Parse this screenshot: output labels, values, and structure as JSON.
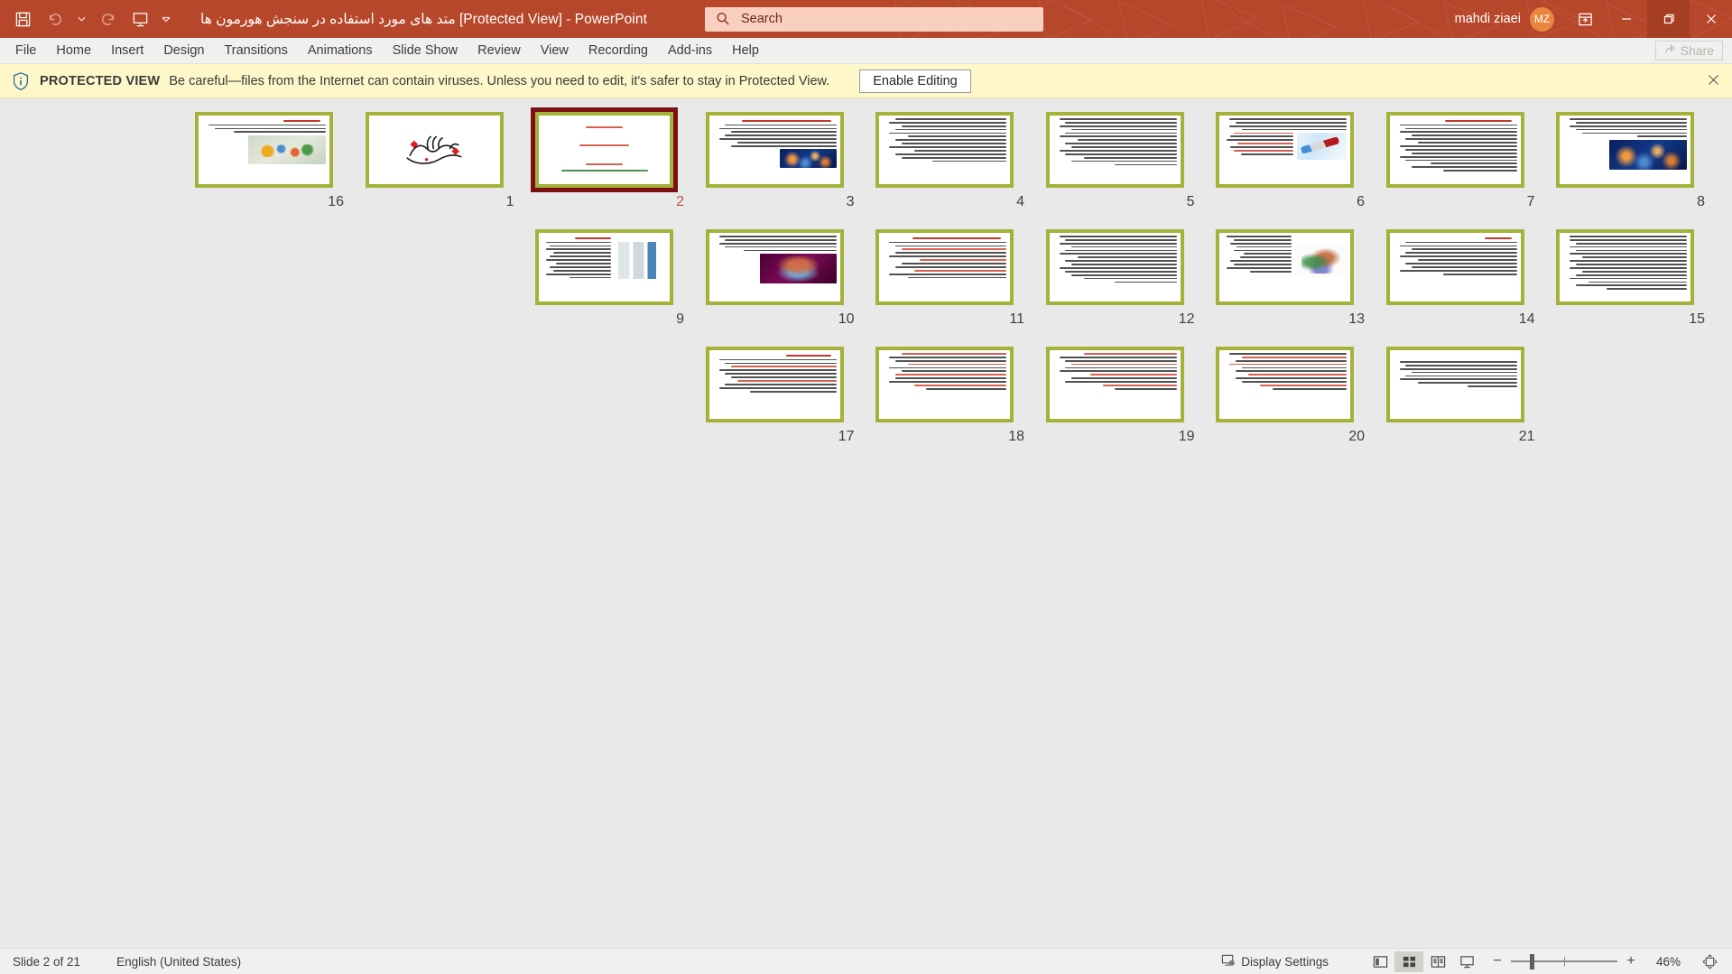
{
  "window": {
    "document_title": "متد های مورد استفاده در سنجش هورمون ها",
    "protected_tag": "[Protected View]",
    "separator": "-",
    "app_name": "PowerPoint",
    "user_name": "mahdi ziaei",
    "avatar_initials": "MZ",
    "accent_color": "#b7472a",
    "avatar_color": "#e8863f"
  },
  "quick_access": {
    "save": "save-icon",
    "undo": "undo-icon",
    "undo_caret": "chevron-down-icon",
    "redo": "redo-icon",
    "present": "start-slideshow-icon",
    "customize": "chevron-down-icon"
  },
  "search": {
    "placeholder": "Search",
    "value": "Search",
    "icon": "search-icon"
  },
  "window_controls": {
    "ribbon_display": "ribbon-display-options-icon",
    "minimize": "minimize-icon",
    "restore": "restore-icon",
    "close": "close-icon"
  },
  "ribbon": {
    "tabs": [
      {
        "label": "File"
      },
      {
        "label": "Home"
      },
      {
        "label": "Insert"
      },
      {
        "label": "Design"
      },
      {
        "label": "Transitions"
      },
      {
        "label": "Animations"
      },
      {
        "label": "Slide Show"
      },
      {
        "label": "Review"
      },
      {
        "label": "View"
      },
      {
        "label": "Recording"
      },
      {
        "label": "Add-ins"
      },
      {
        "label": "Help"
      }
    ],
    "share_label": "Share",
    "share_icon": "share-icon"
  },
  "protected_view": {
    "icon": "info-shield-icon",
    "label": "PROTECTED VIEW",
    "message": "Be careful—files from the Internet can contain viruses. Unless you need to edit, it's safer to stay in Protected View.",
    "enable_button": "Enable Editing",
    "close_icon": "close-icon",
    "background_color": "#fdf7c9"
  },
  "slides": {
    "selected_number": 2,
    "border_color": "#a4b23a",
    "selection_color": "#7b1113",
    "items": [
      {
        "number": 8,
        "image": "neuron",
        "title": "",
        "layout": "text-top-image-left"
      },
      {
        "number": 7,
        "image": "",
        "title": "متد های رادیو ایمونواسی",
        "layout": "text-only"
      },
      {
        "number": 6,
        "image": "tube",
        "title": "",
        "layout": "text-image-inline"
      },
      {
        "number": 5,
        "image": "",
        "title": "",
        "layout": "text-only"
      },
      {
        "number": 4,
        "image": "",
        "title": "",
        "layout": "text-only"
      },
      {
        "number": 3,
        "image": "neuron",
        "title": "متد های مورد استفاده در سنجش هورمون ها",
        "layout": "text-top-image-left"
      },
      {
        "number": 2,
        "image": "",
        "title": "نام استاد :",
        "layout": "title-slide"
      },
      {
        "number": 1,
        "image": "bismillah",
        "title": "",
        "layout": "image-only"
      },
      {
        "number": 16,
        "image": "elisa",
        "title": "مراحل الایزا",
        "layout": "text-top-image-left"
      },
      {
        "number": 15,
        "image": "",
        "title": "",
        "layout": "text-only"
      },
      {
        "number": 14,
        "image": "",
        "title": "",
        "layout": "text-only"
      },
      {
        "number": 13,
        "image": "protein",
        "title": "",
        "layout": "image-left-text-right"
      },
      {
        "number": 12,
        "image": "",
        "title": "",
        "layout": "text-only"
      },
      {
        "number": 11,
        "image": "",
        "title": "متد های مورد استفاده در سنجش هورمون ها",
        "layout": "text-only"
      },
      {
        "number": 10,
        "image": "hypo",
        "title": "",
        "layout": "text-top-image-left"
      },
      {
        "number": 9,
        "image": "lab",
        "title": "کروماتوگرافی گازی",
        "layout": "image-left-text-right"
      },
      {
        "number": 21,
        "image": "",
        "title": "",
        "layout": "text-only"
      },
      {
        "number": 20,
        "image": "",
        "title": "",
        "layout": "text-only-red"
      },
      {
        "number": 19,
        "image": "",
        "title": "",
        "layout": "text-only-red"
      },
      {
        "number": 18,
        "image": "",
        "title": "",
        "layout": "text-only-red"
      },
      {
        "number": 17,
        "image": "",
        "title": "آزمایش های هورمونی",
        "layout": "text-only-red"
      }
    ],
    "slide2_lines": [
      {
        "text": "نام استاد :",
        "color": "red"
      },
      {
        "text": "نام و نام خانوادگی :",
        "color": "red"
      },
      {
        "text": "موضوع تحقیق :",
        "color": "red"
      },
      {
        "text": "متد های مورد استفاده در سنجش هورمونها",
        "color": "green"
      }
    ]
  },
  "status_bar": {
    "slide_counter": "Slide 2 of 21",
    "language": "English (United States)",
    "display_settings": "Display Settings",
    "display_settings_icon": "display-settings-icon",
    "views": [
      {
        "name": "normal-view",
        "icon": "normal-view-icon",
        "active": false
      },
      {
        "name": "slide-sorter-view",
        "icon": "slide-sorter-icon",
        "active": true
      },
      {
        "name": "reading-view",
        "icon": "reading-view-icon",
        "active": false
      },
      {
        "name": "slide-show-view",
        "icon": "slide-show-icon",
        "active": false
      }
    ],
    "zoom_out": "−",
    "zoom_in": "+",
    "zoom_level": "46%",
    "fit_icon": "fit-to-window-icon"
  }
}
